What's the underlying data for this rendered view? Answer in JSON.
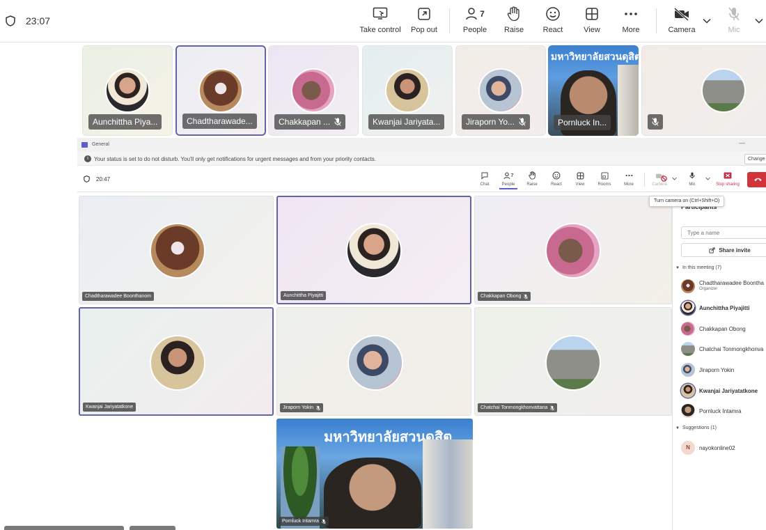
{
  "top_bar": {
    "time": "23:07",
    "buttons": {
      "take_control": "Take control",
      "pop_out": "Pop out",
      "people": "People",
      "people_count": "7",
      "raise": "Raise",
      "react": "React",
      "view": "View",
      "more": "More",
      "camera": "Camera",
      "mic": "Mic"
    }
  },
  "strip": [
    {
      "name": "Aunchittha Piya..."
    },
    {
      "name": "Chadtharawade..."
    },
    {
      "name": "Chakkapan ..."
    },
    {
      "name": "Kwanjai Jariyata..."
    },
    {
      "name": "Jiraporn Yo..."
    },
    {
      "name": "Pornluck In..."
    },
    {
      "name": ""
    }
  ],
  "strip_video_text": "มหาวิทยาลัยสวนดุสิต",
  "inner": {
    "window_title": "General",
    "banner": "Your status is set to do not disturb. You'll only get notifications for urgent messages and from your priority contacts.",
    "banner_button": "Change",
    "time": "20:47",
    "buttons": {
      "chat": "Chat",
      "people": "People",
      "people_count": "7",
      "raise": "Raise",
      "react": "React",
      "view": "View",
      "rooms": "Rooms",
      "more": "More",
      "camera": "Camera",
      "mic": "Mic",
      "stop_sharing": "Stop sharing"
    },
    "tooltip": "Turn camera on (Ctrl+Shift+O)",
    "grid": [
      {
        "name": "Chadtharawadee Boonthanom"
      },
      {
        "name": "Aunchittha Piyajitti"
      },
      {
        "name": "Chakkapan Obong"
      },
      {
        "name": "Kwanjai Jariyatatkone"
      },
      {
        "name": "Jiraporn Yokin"
      },
      {
        "name": "Chatchai Tonmongkhonvattana"
      },
      {
        "name": "Pornluck Intamra"
      }
    ],
    "grid_video_text": "มหาวิทยาลัยสวนดุสิต"
  },
  "panel": {
    "title": "Participants",
    "search_placeholder": "Type a name",
    "share_invite": "Share invite",
    "in_meeting": "In this meeting (7)",
    "participants": [
      {
        "name": "Chadtharawadee Boontha",
        "role": "Organizer"
      },
      {
        "name": "Aunchittha Piyajitti",
        "role": ""
      },
      {
        "name": "Chakkapan Obong",
        "role": ""
      },
      {
        "name": "Chatchai Tonmongkhonva",
        "role": ""
      },
      {
        "name": "Jiraporn Yokin",
        "role": ""
      },
      {
        "name": "Kwanjai Jariyatatkone",
        "role": ""
      },
      {
        "name": "Pornluck Intamra",
        "role": ""
      }
    ],
    "suggestions": "Suggestions (1)",
    "suggestion": {
      "initial": "N",
      "name": "nayokonline02"
    }
  },
  "colors": {
    "accent": "#6264a7",
    "stop_sharing": "#c4314b",
    "leave": "#d13438"
  }
}
